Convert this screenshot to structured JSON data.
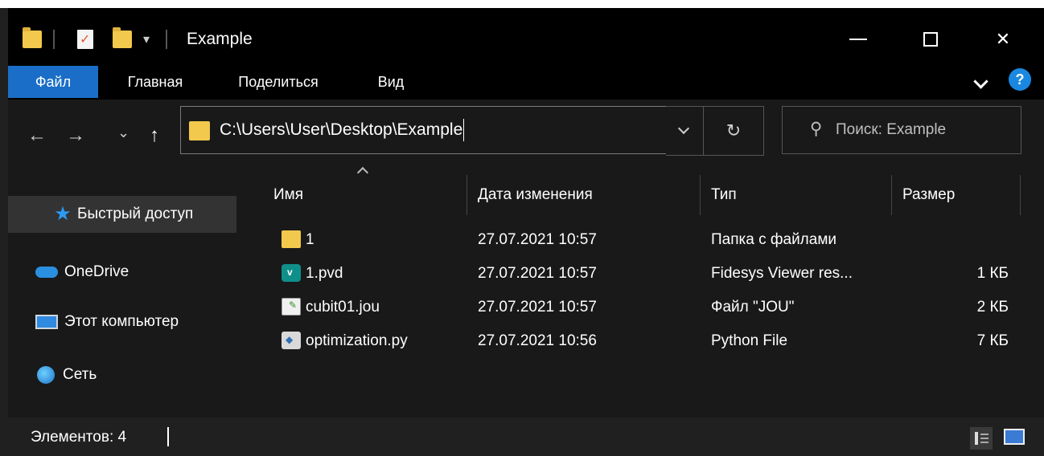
{
  "window": {
    "title": "Example",
    "qat_dropdown": "▾",
    "minimize": "",
    "maximize": "",
    "close": "✕"
  },
  "ribbon": {
    "tabs": [
      "Файл",
      "Главная",
      "Поделиться",
      "Вид"
    ],
    "help": "?"
  },
  "nav": {
    "back": "←",
    "forward": "→",
    "recent": "⌄",
    "up": "↑",
    "address": "C:\\Users\\User\\Desktop\\Example",
    "refresh": "↻",
    "search_placeholder": "Поиск: Example"
  },
  "sidebar": {
    "items": [
      {
        "label": "Быстрый доступ",
        "icon": "star-icon"
      },
      {
        "label": "OneDrive",
        "icon": "cloud-icon"
      },
      {
        "label": "Этот компьютер",
        "icon": "computer-icon"
      },
      {
        "label": "Сеть",
        "icon": "network-icon"
      }
    ]
  },
  "files": {
    "columns": [
      "Имя",
      "Дата изменения",
      "Тип",
      "Размер"
    ],
    "rows": [
      {
        "name": "1",
        "date": "27.07.2021 10:57",
        "type": "Папка с файлами",
        "size": "",
        "icon": "folder-icon"
      },
      {
        "name": "1.pvd",
        "date": "27.07.2021 10:57",
        "type": "Fidesys Viewer res...",
        "size": "1 КБ",
        "icon": "pvd-file-icon"
      },
      {
        "name": "cubit01.jou",
        "date": "27.07.2021 10:57",
        "type": "Файл \"JOU\"",
        "size": "2 КБ",
        "icon": "jou-file-icon"
      },
      {
        "name": "optimization.py",
        "date": "27.07.2021 10:56",
        "type": "Python File",
        "size": "7 КБ",
        "icon": "python-file-icon"
      }
    ]
  },
  "status": {
    "items_count": "Элементов: 4"
  },
  "colors": {
    "accent": "#1a6ec7",
    "background": "#191919",
    "folder": "#f2c94c"
  }
}
